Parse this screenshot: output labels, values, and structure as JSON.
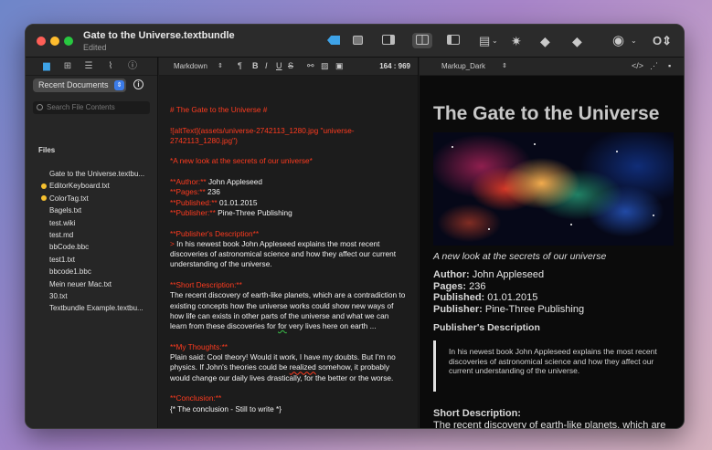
{
  "window": {
    "title": "Gate to the Universe.textbundle",
    "subtitle": "Edited"
  },
  "sidebar": {
    "dropdown_label": "Recent Documents",
    "search_placeholder": "Search File Contents",
    "files_heading": "Files",
    "files": [
      {
        "name": "Gate to the Universe.textbu...",
        "tagged": false
      },
      {
        "name": "EditorKeyboard.txt",
        "tagged": true
      },
      {
        "name": "ColorTag.txt",
        "tagged": true
      },
      {
        "name": "Bagels.txt",
        "tagged": false
      },
      {
        "name": "test.wiki",
        "tagged": false
      },
      {
        "name": "test.md",
        "tagged": false
      },
      {
        "name": "bbCode.bbc",
        "tagged": false
      },
      {
        "name": "test1.txt",
        "tagged": false
      },
      {
        "name": "bbcode1.bbc",
        "tagged": false
      },
      {
        "name": "Mein neuer Mac.txt",
        "tagged": false
      },
      {
        "name": "30.txt",
        "tagged": false
      },
      {
        "name": "Textbundle Example.textbu...",
        "tagged": false
      }
    ]
  },
  "editor": {
    "mode": "Markdown",
    "counter": "164 : 969",
    "format_buttons": [
      "¶",
      "B",
      "I",
      "U",
      "S"
    ],
    "lines": {
      "heading": "# The Gate to the Universe #",
      "image": "![altText](assets/universe-2742113_1280.jpg \"universe-2742113_1280.jpg\")",
      "tagline": "*A new look at the secrets of our universe*",
      "author_md": "**Author:**",
      "author_val": " John Appleseed",
      "pages_md": "**Pages:**",
      "pages_val": " 236",
      "published_md": "**Published:**",
      "published_val": " 01.01.2015",
      "publisher_md": "**Publisher:**",
      "publisher_val": " Pine-Three Publishing",
      "desc_head": "**Publisher's Description**",
      "desc_marker": ">",
      "desc_text": " In his newest book John Appleseed explains the most recent discoveries of astronomical science and how they affect our current understanding of the universe.",
      "short_head": "**Short Description:**",
      "short_text_pre": " The recent discovery of earth-like planets, which are a contradiction to existing concepts how the universe works could show new ways of how life can exists in other parts of the universe and what we can learn from these discoveries for ",
      "short_text_for": "for",
      "short_text_post": " very lives here on earth ...",
      "thoughts_head": "**My Thoughts:**",
      "thoughts_pre": " Plain said: Cool theory! Would it work, I have my doubts. But I'm no physics. If John's theories could be ",
      "thoughts_realized": "realized",
      "thoughts_post": " somehow, it probably would change our daily lives drastically, for the better or the worse.",
      "conclusion_head": "**Conclusion:**",
      "conclusion_text": " {* The conclusion - Still to write *}"
    }
  },
  "preview": {
    "theme": "Markup_Dark",
    "title": "The Gate to the Universe",
    "subtitle": "A new look at the secrets of our universe",
    "author_label": "Author:",
    "author": "John Appleseed",
    "pages_label": "Pages:",
    "pages": "236",
    "published_label": "Published:",
    "published": "01.01.2015",
    "publisher_label": "Publisher:",
    "publisher": "Pine-Three Publishing",
    "desc_heading": "Publisher's Description",
    "desc_text": "In his newest book John Appleseed explains the most recent discoveries of astronomical science and how they affect our current understanding of the universe.",
    "short_heading": "Short Description:",
    "short_text": "The recent discovery of earth-like planets, which are"
  },
  "colors": {
    "accent": "#3ea3e8",
    "markdown_syntax": "#ff3b1f",
    "tag_yellow": "#f5c02f"
  }
}
